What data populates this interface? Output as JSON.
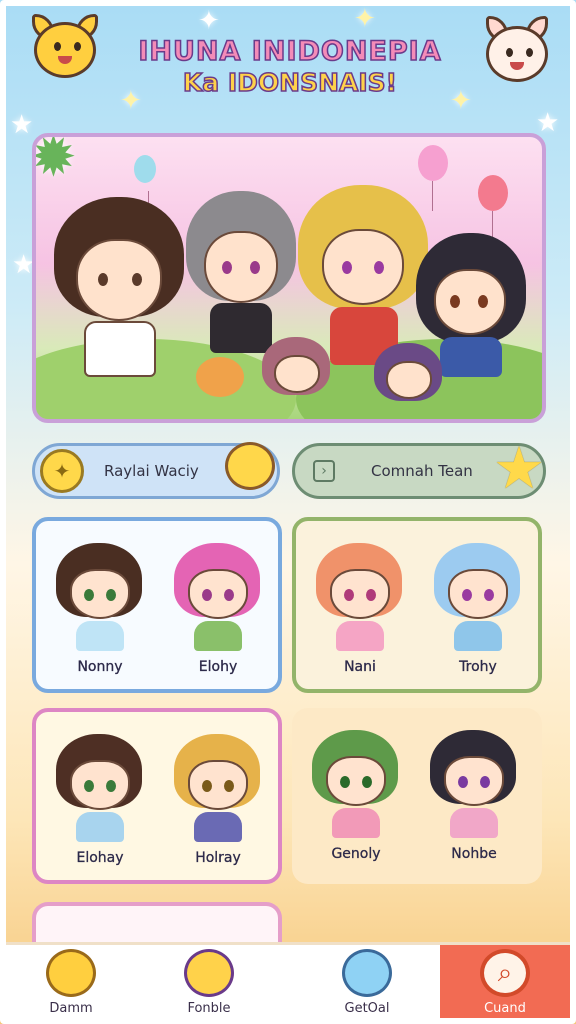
{
  "header": {
    "title": "IHUNA INIDONEPIA",
    "subtitle": "Ka IDONSNAIS!"
  },
  "chips": {
    "left": {
      "label": "Raylai Waciy",
      "icon": "star-icon"
    },
    "right": {
      "label": "Comnah Tean",
      "icon": "chevron-right-icon"
    }
  },
  "cards": [
    {
      "characters": [
        {
          "name": "Nonny"
        },
        {
          "name": "Elohy"
        }
      ]
    },
    {
      "characters": [
        {
          "name": "Nani"
        },
        {
          "name": "Trohy"
        }
      ]
    },
    {
      "characters": [
        {
          "name": "Elohay"
        },
        {
          "name": "Holray"
        }
      ]
    },
    {
      "characters": [
        {
          "name": "Genoly"
        },
        {
          "name": "Nohbe"
        }
      ]
    }
  ],
  "nav": [
    {
      "label": "Damm",
      "icon": "blob-icon"
    },
    {
      "label": "Fonble",
      "icon": "mascot-icon"
    },
    {
      "label": "GetOal",
      "icon": "slime-icon"
    },
    {
      "label": "Cuand",
      "icon": "search-icon"
    }
  ],
  "colors": {
    "accent_pink": "#f48bb8",
    "accent_yellow": "#ffd24a",
    "nav_active": "#f26b53",
    "card_blue": "#79a9de",
    "card_green": "#93b46a",
    "card_pink": "#dd86c4"
  }
}
